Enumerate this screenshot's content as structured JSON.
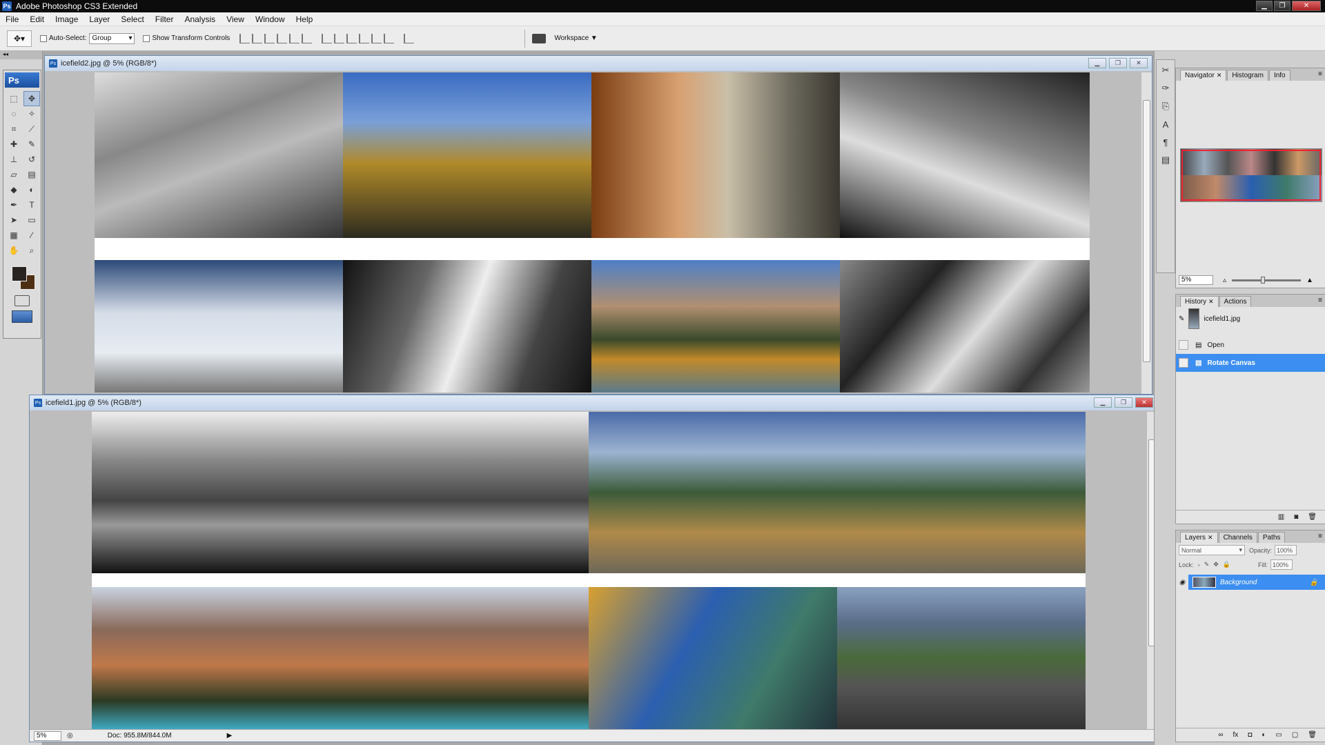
{
  "app": {
    "title": "Adobe Photoshop CS3 Extended",
    "badge": "Ps"
  },
  "menu": [
    "File",
    "Edit",
    "Image",
    "Layer",
    "Select",
    "Filter",
    "Analysis",
    "View",
    "Window",
    "Help"
  ],
  "options": {
    "auto_select_label": "Auto-Select:",
    "auto_select_value": "Group",
    "show_transform_label": "Show Transform Controls",
    "workspace_label": "Workspace ▼"
  },
  "tools_logo": "Ps",
  "doc2": {
    "title": "icefield2.jpg @ 5% (RGB/8*)",
    "tiles": [
      {
        "g": "linear-gradient(160deg,#ddd 0%,#888 35%,#bbb 55%,#333 100%)"
      },
      {
        "g": "linear-gradient(180deg,#3a6bc2 0%,#7aa0d8 30%,#b08a2a 55%,#2c2a1f 100%)"
      },
      {
        "g": "linear-gradient(90deg,#7a3d12 0%,#d8a070 35%,#c9bfa8 55%,#6d6a5e 80%,#3a3630 100%)"
      },
      {
        "g": "linear-gradient(200deg,#222 0%,#888 40%,#ddd 60%,#111 100%)"
      },
      {
        "g": "linear-gradient(180deg,#2b4a78 0%,#d6dde8 40%,#e7ecf2 70%,#777 100%)"
      },
      {
        "g": "linear-gradient(110deg,#111 0%,#666 30%,#eee 50%,#444 75%,#111 100%)"
      },
      {
        "g": "linear-gradient(180deg,#4f7fc7 0%,#b09070 35%,#3a4a2a 60%,#c18a2a 75%,#5b7a8a 100%)"
      },
      {
        "g": "linear-gradient(130deg,#888 0%,#222 30%,#ddd 55%,#333 80%,#999 100%)"
      }
    ]
  },
  "doc1": {
    "title": "icefield1.jpg @ 5% (RGB/8*)",
    "status_zoom": "5%",
    "status_doc": "Doc: 955.8M/844.0M",
    "tiles": [
      {
        "g": "linear-gradient(180deg,#eee 0%,#888 30%,#444 55%,#999 70%,#111 100%)"
      },
      {
        "g": "linear-gradient(180deg,#4a6aa8 0%,#9cb4d0 25%,#3c5a3a 50%,#b08a4a 75%,#6e6858 100%)"
      },
      {
        "g": "linear-gradient(180deg,#c9d2e0 0%,#8a6a5a 30%,#c0784a 55%,#2c3a22 80%,#3fa9c2 100%)"
      },
      {
        "g": "linear-gradient(120deg,#d8a030 0%,#2b5fb0 40%,#3f7a6a 70%,#22333a 100%)"
      },
      {
        "g": "linear-gradient(180deg,#8aa0c0 0%,#5a6e8a 25%,#4a6a3a 50%,#555 70%,#333 100%)"
      }
    ]
  },
  "navigator": {
    "tabs": [
      "Navigator",
      "Histogram",
      "Info"
    ],
    "zoom": "5%"
  },
  "history": {
    "tabs": [
      "History",
      "Actions"
    ],
    "snapshot": "icefield1.jpg",
    "items": [
      "Open",
      "Rotate Canvas"
    ]
  },
  "layers": {
    "tabs": [
      "Layers",
      "Channels",
      "Paths"
    ],
    "blend": "Normal",
    "opacity_label": "Opacity:",
    "opacity": "100%",
    "lock_label": "Lock:",
    "fill_label": "Fill:",
    "fill": "100%",
    "layer_name": "Background"
  },
  "colors": {
    "selection": "#3c8ef0",
    "foreground": "#2a2420",
    "background": "#4e2f14"
  }
}
